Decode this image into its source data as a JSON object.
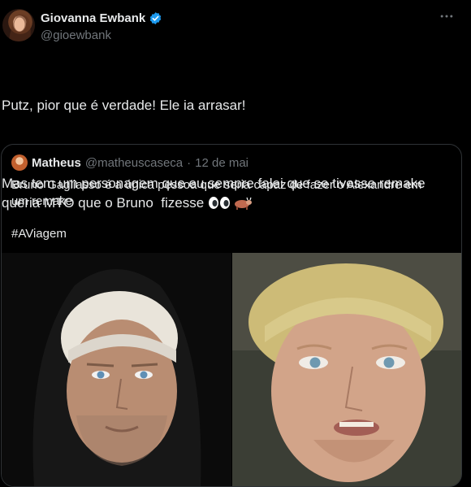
{
  "author": {
    "name": "Giovanna Ewbank",
    "handle": "@gioewbank",
    "verified_color": "#1d9bf0"
  },
  "tweet": {
    "line1": "Putz, pior que é verdade! Ele ia arrasar!",
    "line2": "Mas tem um personagem que eu sempre falei que se tivesse remake queria MTO que o Bruno  fizesse"
  },
  "quoted": {
    "name": "Matheus",
    "handle": "@matheuscaseca",
    "separator": "·",
    "date": "12 de mai",
    "text": "Bruno Gagliasso é a única pessoa que seria capaz de fazer o Alexandre em um remake",
    "hashtag": "#AViagem"
  },
  "icons": {
    "more": "more-horizontal-icon",
    "verified": "verified-badge-icon",
    "emoji_1": "eyes-emoji-icon",
    "emoji_2": "ox-emoji-icon"
  },
  "colors": {
    "background": "#000000",
    "text": "#e7e9ea",
    "secondary": "#71767b",
    "border": "#2f3336",
    "accent": "#1d9bf0"
  }
}
